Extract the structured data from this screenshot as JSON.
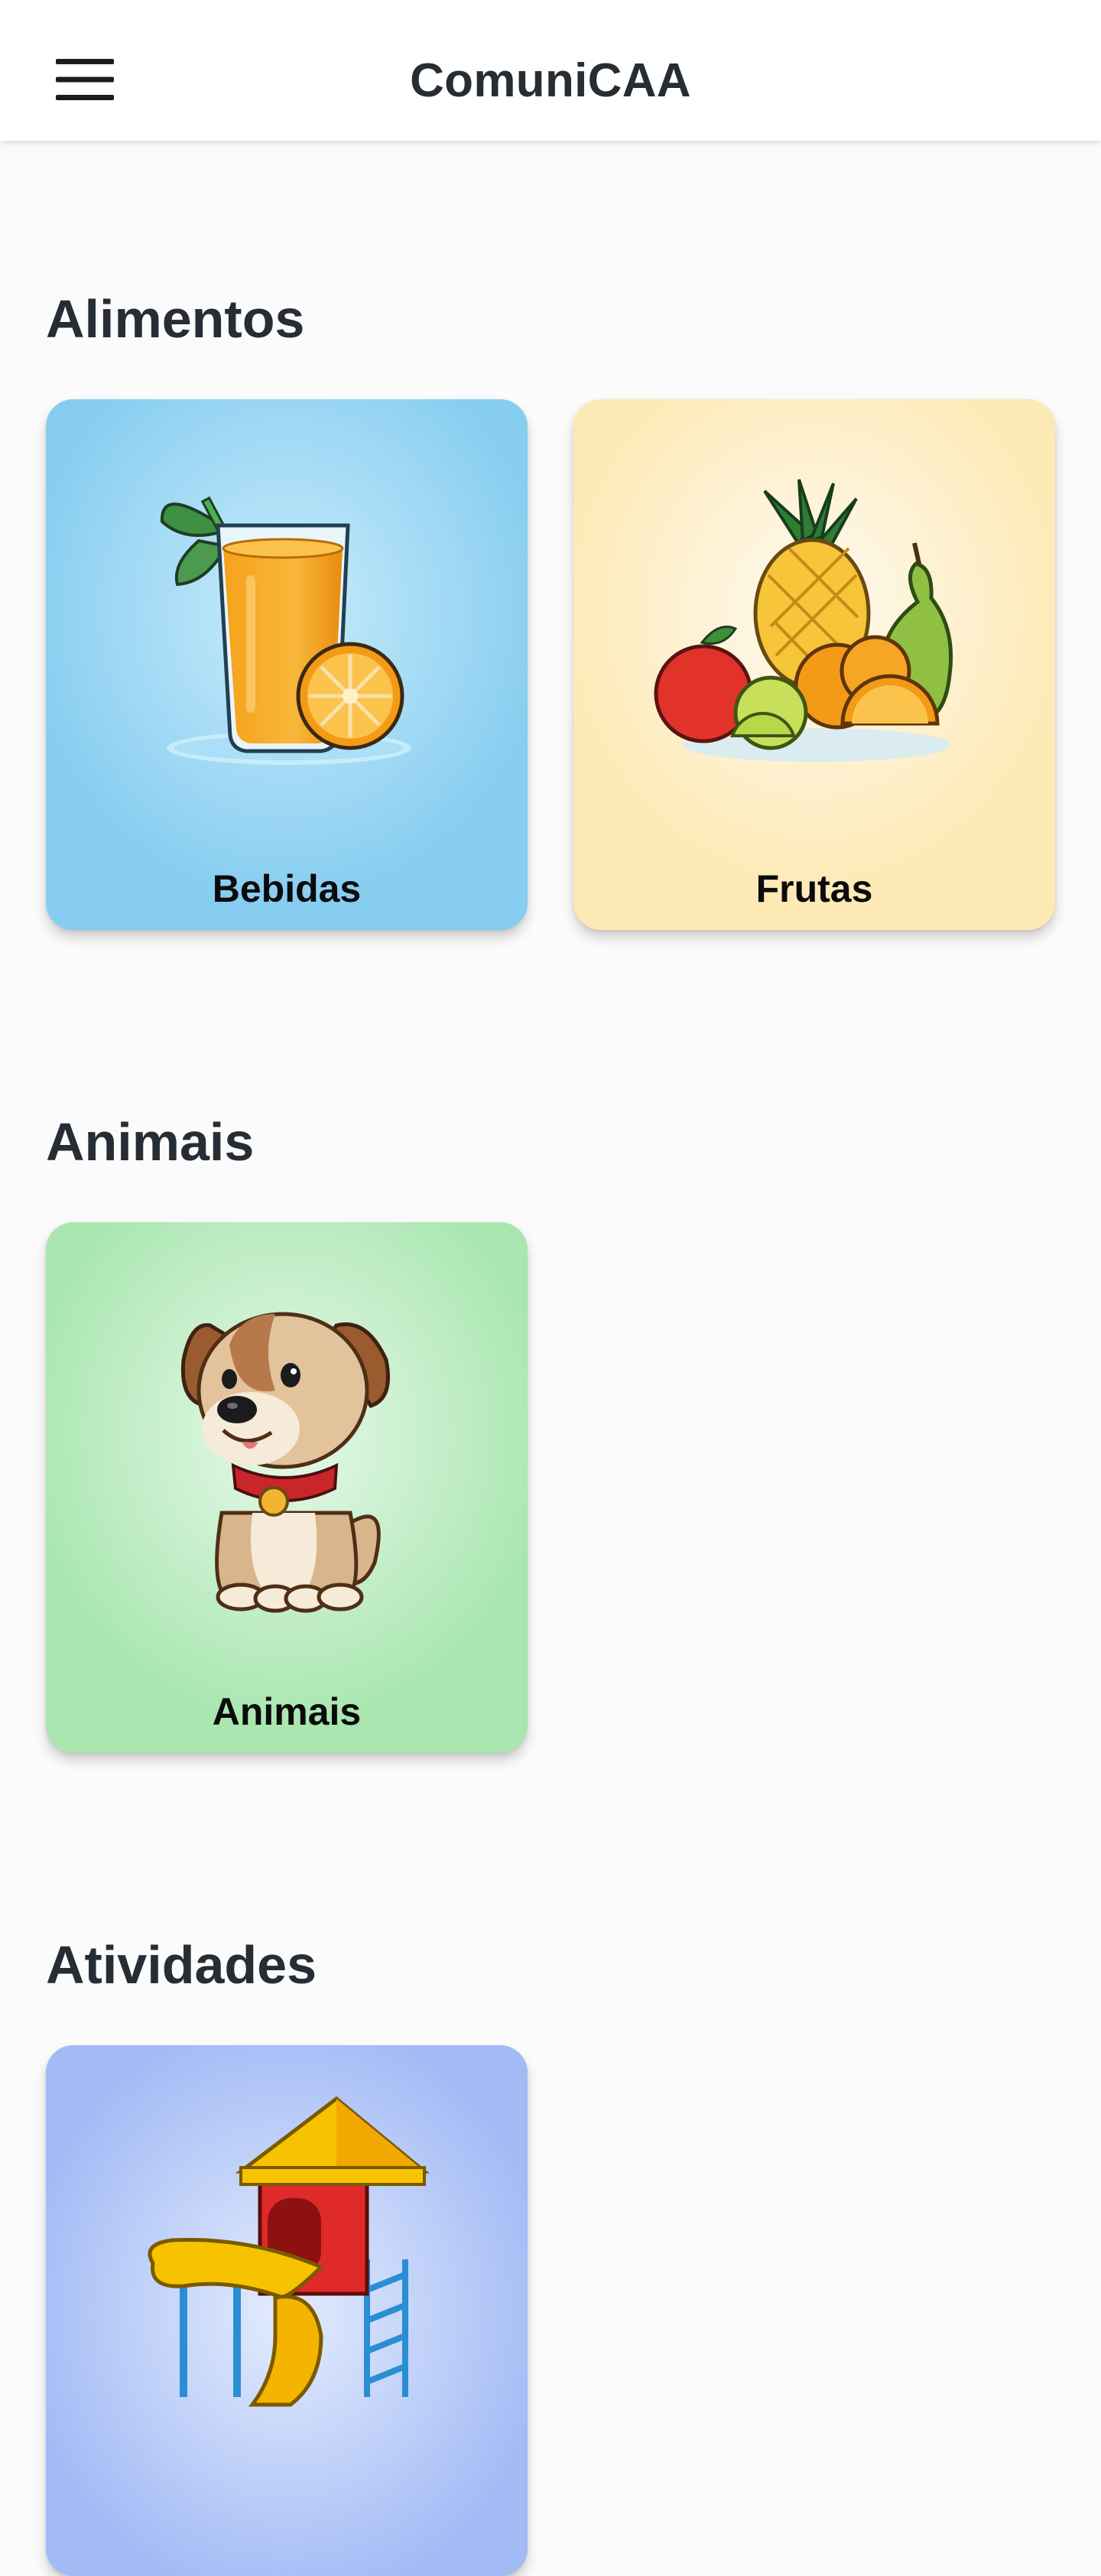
{
  "app_bar": {
    "title": "ComuniCAA",
    "menu_icon": "menu-icon"
  },
  "colors": {
    "page_background": "#fcfbfb",
    "app_bar_background": "#ffffff",
    "card_bebidas": "#87cdf0",
    "card_frutas": "#fde9b4",
    "card_animais": "#a9e6b0",
    "card_parquinho": "#a3bbf5"
  },
  "sections": [
    {
      "title": "Alimentos",
      "cards": [
        {
          "label": "Bebidas",
          "image": "orange-juice-icon"
        },
        {
          "label": "Frutas",
          "image": "fruit-bowl-icon"
        }
      ]
    },
    {
      "title": "Animais",
      "cards": [
        {
          "label": "Animais",
          "image": "puppy-icon"
        }
      ]
    },
    {
      "title": "Atividades",
      "cards": [
        {
          "label": "",
          "image": "playground-slide-icon"
        }
      ]
    }
  ]
}
